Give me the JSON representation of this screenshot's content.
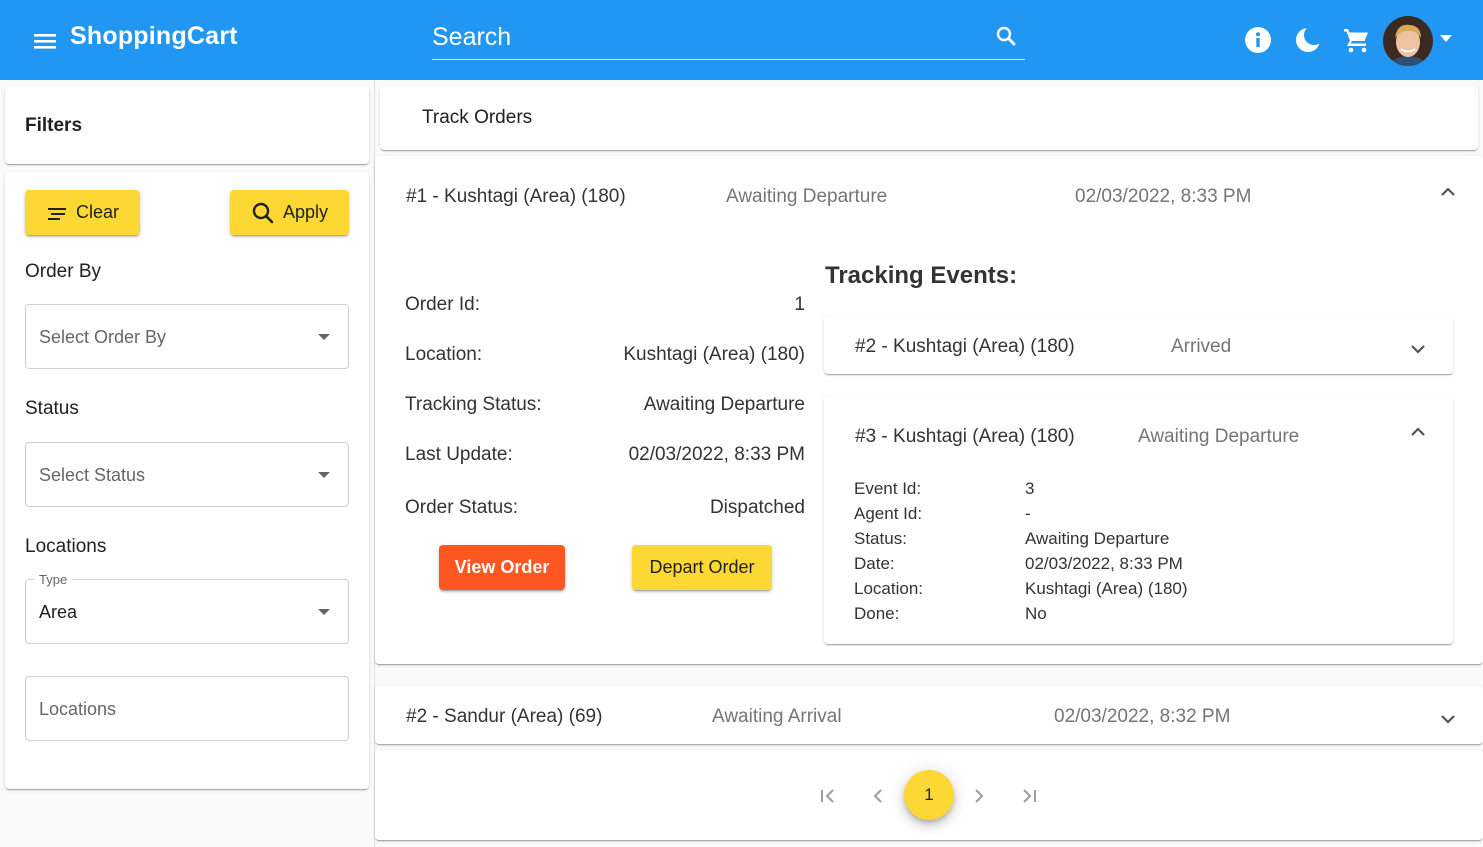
{
  "app": {
    "brand": "ShoppingCart",
    "search_placeholder": "Search",
    "accent": "#2196f3",
    "header_icons": [
      "menu-icon",
      "search-icon",
      "info-icon",
      "dark-mode-icon",
      "cart-icon",
      "avatar",
      "chevron-down-icon"
    ]
  },
  "filters": {
    "title": "Filters",
    "clear_label": "Clear",
    "apply_label": "Apply",
    "order_by_label": "Order By",
    "order_by_value": "Select Order By",
    "status_label": "Status",
    "status_value": "Select Status",
    "locations_label": "Locations",
    "type_legend": "Type",
    "type_value": "Area",
    "locations_placeholder": "Locations"
  },
  "main": {
    "title": "Track Orders",
    "orders": [
      {
        "header": "#1 - Kushtagi (Area) (180)",
        "status": "Awaiting Departure",
        "datetime": "02/03/2022, 8:33 PM",
        "expanded": true,
        "details": {
          "order_id_label": "Order Id:",
          "order_id": "1",
          "location_label": "Location:",
          "location": "Kushtagi (Area) (180)",
          "tracking_status_label": "Tracking Status:",
          "tracking_status": "Awaiting Departure",
          "last_update_label": "Last Update:",
          "last_update": "02/03/2022, 8:33 PM",
          "order_status_label": "Order Status:",
          "order_status": "Dispatched"
        },
        "view_order_label": "View Order",
        "depart_order_label": "Depart Order",
        "tracking_events_title": "Tracking Events:",
        "events": [
          {
            "header": "#2 - Kushtagi (Area) (180)",
            "status": "Arrived",
            "expanded": false
          },
          {
            "header": "#3 - Kushtagi (Area) (180)",
            "status": "Awaiting Departure",
            "expanded": true,
            "fields": [
              {
                "label": "Event Id:",
                "value": "3"
              },
              {
                "label": "Agent Id:",
                "value": "-"
              },
              {
                "label": "Status:",
                "value": "Awaiting Departure"
              },
              {
                "label": "Date:",
                "value": "02/03/2022, 8:33 PM"
              },
              {
                "label": "Location:",
                "value": "Kushtagi (Area) (180)"
              },
              {
                "label": "Done:",
                "value": "No"
              }
            ]
          }
        ]
      },
      {
        "header": "#2 - Sandur (Area) (69)",
        "status": "Awaiting Arrival",
        "datetime": "02/03/2022, 8:32 PM",
        "expanded": false
      }
    ]
  },
  "pagination": {
    "current_page": "1"
  }
}
